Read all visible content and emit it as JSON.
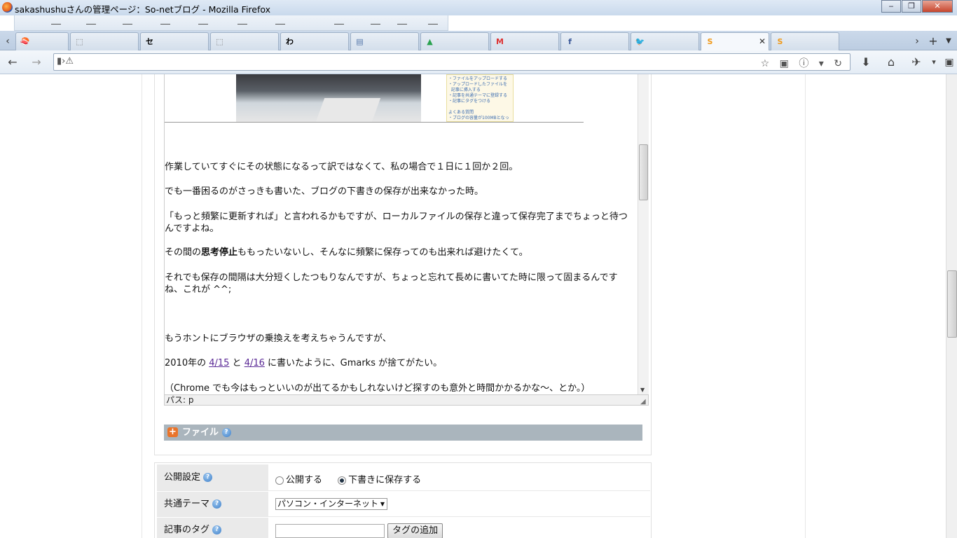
{
  "window": {
    "title": "sakashushuさんの管理ページ：So-netブログ - Mozilla Firefox",
    "minimize": "‒",
    "maximize": "❐",
    "close": "✕"
  },
  "tabs": [
    {
      "icon": "sushi-icon",
      "glyph": "🍣",
      "color": "#d22"
    },
    {
      "icon": "blank-page-icon",
      "glyph": "⬚",
      "color": "#777"
    },
    {
      "icon": "se-icon",
      "glyph": "セ",
      "color": "#000"
    },
    {
      "icon": "blank-page-icon",
      "glyph": "⬚",
      "color": "#777"
    },
    {
      "icon": "wa-icon",
      "glyph": "わ",
      "color": "#000"
    },
    {
      "icon": "document-icon",
      "glyph": "▤",
      "color": "#5577aa"
    },
    {
      "icon": "drive-icon",
      "glyph": "▲",
      "color": "#2aa24f"
    },
    {
      "icon": "gmail-icon",
      "glyph": "M",
      "color": "#d33"
    },
    {
      "icon": "facebook-icon",
      "glyph": "f",
      "color": "#3b5998"
    },
    {
      "icon": "twitter-icon",
      "glyph": "🐦",
      "color": "#2aa3ef"
    },
    {
      "icon": "sonet-icon",
      "glyph": "S",
      "color": "#f09a1a",
      "active": true,
      "close": "✕"
    },
    {
      "icon": "sonet-icon",
      "glyph": "S",
      "color": "#f09a1a"
    }
  ],
  "navbar": {
    "back": "←",
    "forward": "→",
    "site_identity": "▮›⚠",
    "url_right_icons": "☆ ▣ ⓘ ▾ ↻",
    "download": "⬇",
    "home": "⌂",
    "addon": "✈",
    "menu": "▾"
  },
  "editor": {
    "paragraphs": [
      "作業していてすぐにその状態になるって訳ではなくて、私の場合で１日に１回か２回。",
      "でも一番困るのがさっきも書いた、ブログの下書きの保存が出来なかった時。",
      "「もっと頻繁に更新すれば」と言われるかもですが、ローカルファイルの保存と違って保存完了までちょっと待つんですよね。",
      "もうホントにブラウザの乗換えを考えちゃうんですが、",
      "（Chrome でも今はもっといいのが出てるかもしれないけど探すのも意外と時間かかるかな〜、とか。）"
    ],
    "p4_before": "その間の",
    "p4_bold": "思考停止",
    "p4_after": "ももったいないし、そんなに頻繁に保存ってのも出来れば避けたくて。",
    "p5": "それでも保存の間隔は大分短くしたつもりなんですが、ちょっと忘れて長めに書いてた時に限って固まるんですね、これが ^^;",
    "p7_before": "2010年の ",
    "p7_link1": "4/15",
    "p7_mid": " と ",
    "p7_link2": "4/16",
    "p7_after": " に書いたように、Gmarks が捨てがたい。",
    "image_text": "・ファイルをアップロードする\n・アップロードしたファイルを\n  記事に挿入する\n・記事を共通テーマに登録する\n・記事にタグをつける\n\nよくある質問\n・ブログの容量が100MBとなっ"
  },
  "pathbar": "パス: p",
  "file_section": {
    "label": "ファイル"
  },
  "settings": {
    "publish_label": "公開設定",
    "publish_option": "公開する",
    "draft_option": "下書きに保存する",
    "theme_label": "共通テーマ",
    "theme_value": "パソコン・インターネット",
    "tag_label": "記事のタグ",
    "tag_button": "タグの追加"
  }
}
